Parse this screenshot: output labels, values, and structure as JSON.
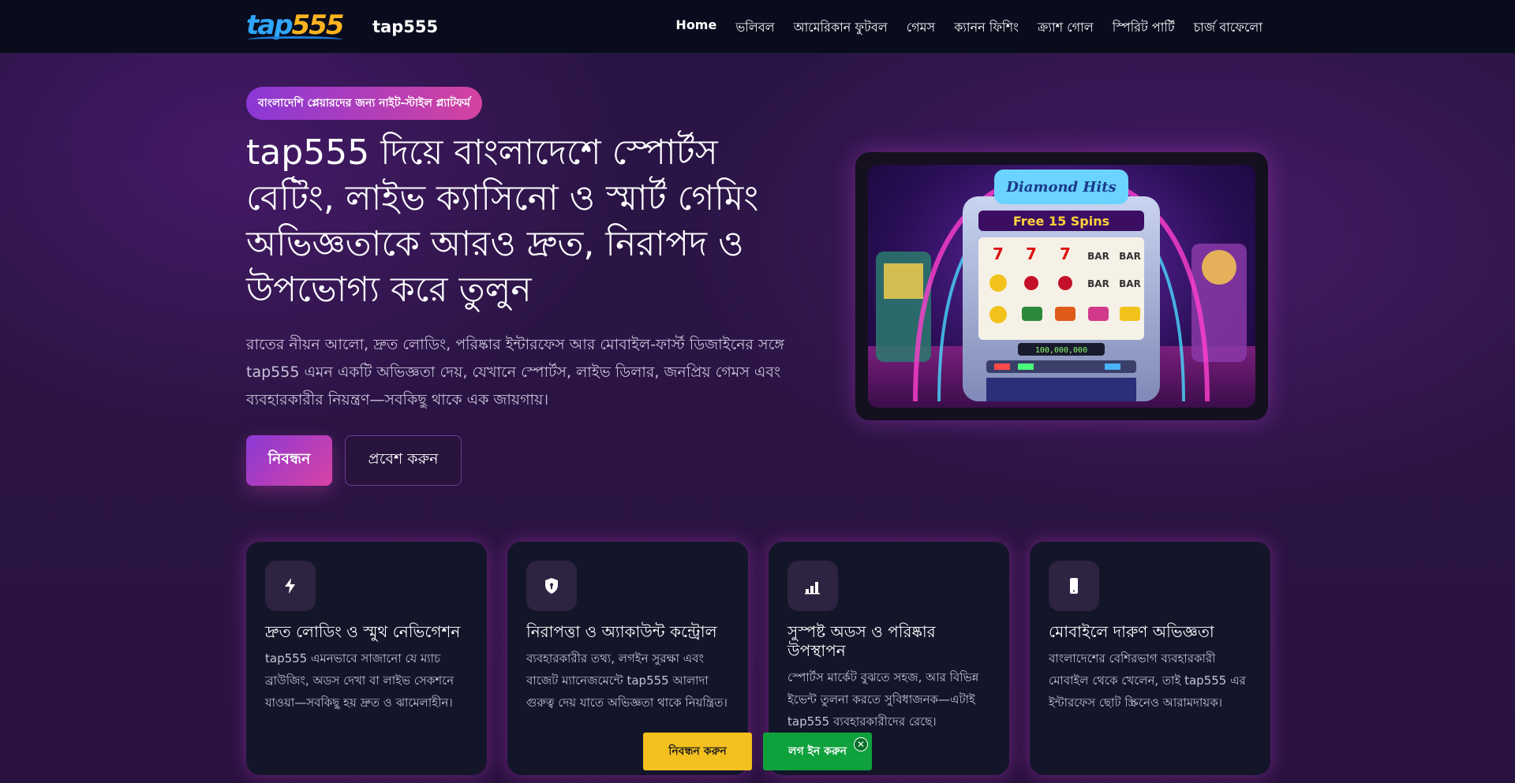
{
  "brand": {
    "logo_part1": "tap",
    "logo_part2": "555",
    "name": "tap555"
  },
  "nav": {
    "items": [
      {
        "label": "Home",
        "active": true
      },
      {
        "label": "ভলিবল"
      },
      {
        "label": "আমেরিকান ফুটবল"
      },
      {
        "label": "গেমস"
      },
      {
        "label": "ক্যানন ফিশিং"
      },
      {
        "label": "ক্র্যাশ গোল"
      },
      {
        "label": "স্পিরিট পার্টি"
      },
      {
        "label": "চার্জ বাফেলো"
      }
    ]
  },
  "hero": {
    "pill": "বাংলাদেশি প্লেয়ারদের জন্য নাইট-স্টাইল প্ল্যাটফর্ম",
    "title": "tap555 দিয়ে বাংলাদেশে স্পোর্টস বেটিং, লাইভ ক্যাসিনো ও স্মার্ট গেমিং অভিজ্ঞতাকে আরও দ্রুত, নিরাপদ ও উপভোগ্য করে তুলুন",
    "description": "রাতের নীয়ন আলো, দ্রুত লোডিং, পরিষ্কার ইন্টারফেস আর মোবাইল-ফার্স্ট ডিজাইনের সঙ্গে tap555 এমন একটি অভিজ্ঞতা দেয়, যেখানে স্পোর্টস, লাইভ ডিলার, জনপ্রিয় গেমস এবং ব্যবহারকারীর নিয়ন্ত্রণ—সবকিছু থাকে এক জায়গায়।",
    "register_label": "নিবন্ধন",
    "login_label": "প্রবেশ করুন",
    "image_sign": "Diamond Hits",
    "image_banner": "Free 15 Spins",
    "image_counter": "100,000,000"
  },
  "features": [
    {
      "icon": "lightning-icon",
      "title": "দ্রুত লোডিং ও স্মুথ নেভিগেশন",
      "text": "tap555 এমনভাবে সাজানো যে ম্যাচ ব্রাউজিং, অডস দেখা বা লাইভ সেকশনে যাওয়া—সবকিছু হয় দ্রুত ও ঝামেলাহীন।"
    },
    {
      "icon": "shield-icon",
      "title": "নিরাপত্তা ও অ্যাকাউন্ট কন্ট্রোল",
      "text": "ব্যবহারকারীর তথ্য, লগইন সুরক্ষা এবং বাজেট ম্যানেজমেন্টে tap555 আলাদা গুরুত্ব দেয় যাতে অভিজ্ঞতা থাকে নিয়ন্ত্রিত।"
    },
    {
      "icon": "bar-chart-icon",
      "title": "সুস্পষ্ট অডস ও পরিষ্কার উপস্থাপন",
      "text": "স্পোর্টস মার্কেট বুঝতে সহজ, আর বিভিন্ন ইভেন্ট তুলনা করতে সুবিধাজনক—এটাই tap555 ব্যবহারকারীদের রেছে।"
    },
    {
      "icon": "mobile-icon",
      "title": "মোবাইলে দারুণ অভিজ্ঞতা",
      "text": "বাংলাদেশের বেশিরভাগ ব্যবহারকারী মোবাইল থেকে খেলেন, তাই tap555 এর ইন্টারফেস ছোট স্ক্রিনেও আরামদায়ক।"
    }
  ],
  "sticky": {
    "register_label": "নিবন্ধন করুন",
    "login_label": "লগ ইন করুন",
    "close_label": "✕"
  },
  "colors": {
    "topbar": "#0a0c1e",
    "background": "#2a1446",
    "accent_gradient_start": "#8a38d6",
    "accent_gradient_end": "#d443a0",
    "card": "#131629",
    "sticky_register": "#f4c01e",
    "sticky_login": "#0ea13c"
  }
}
